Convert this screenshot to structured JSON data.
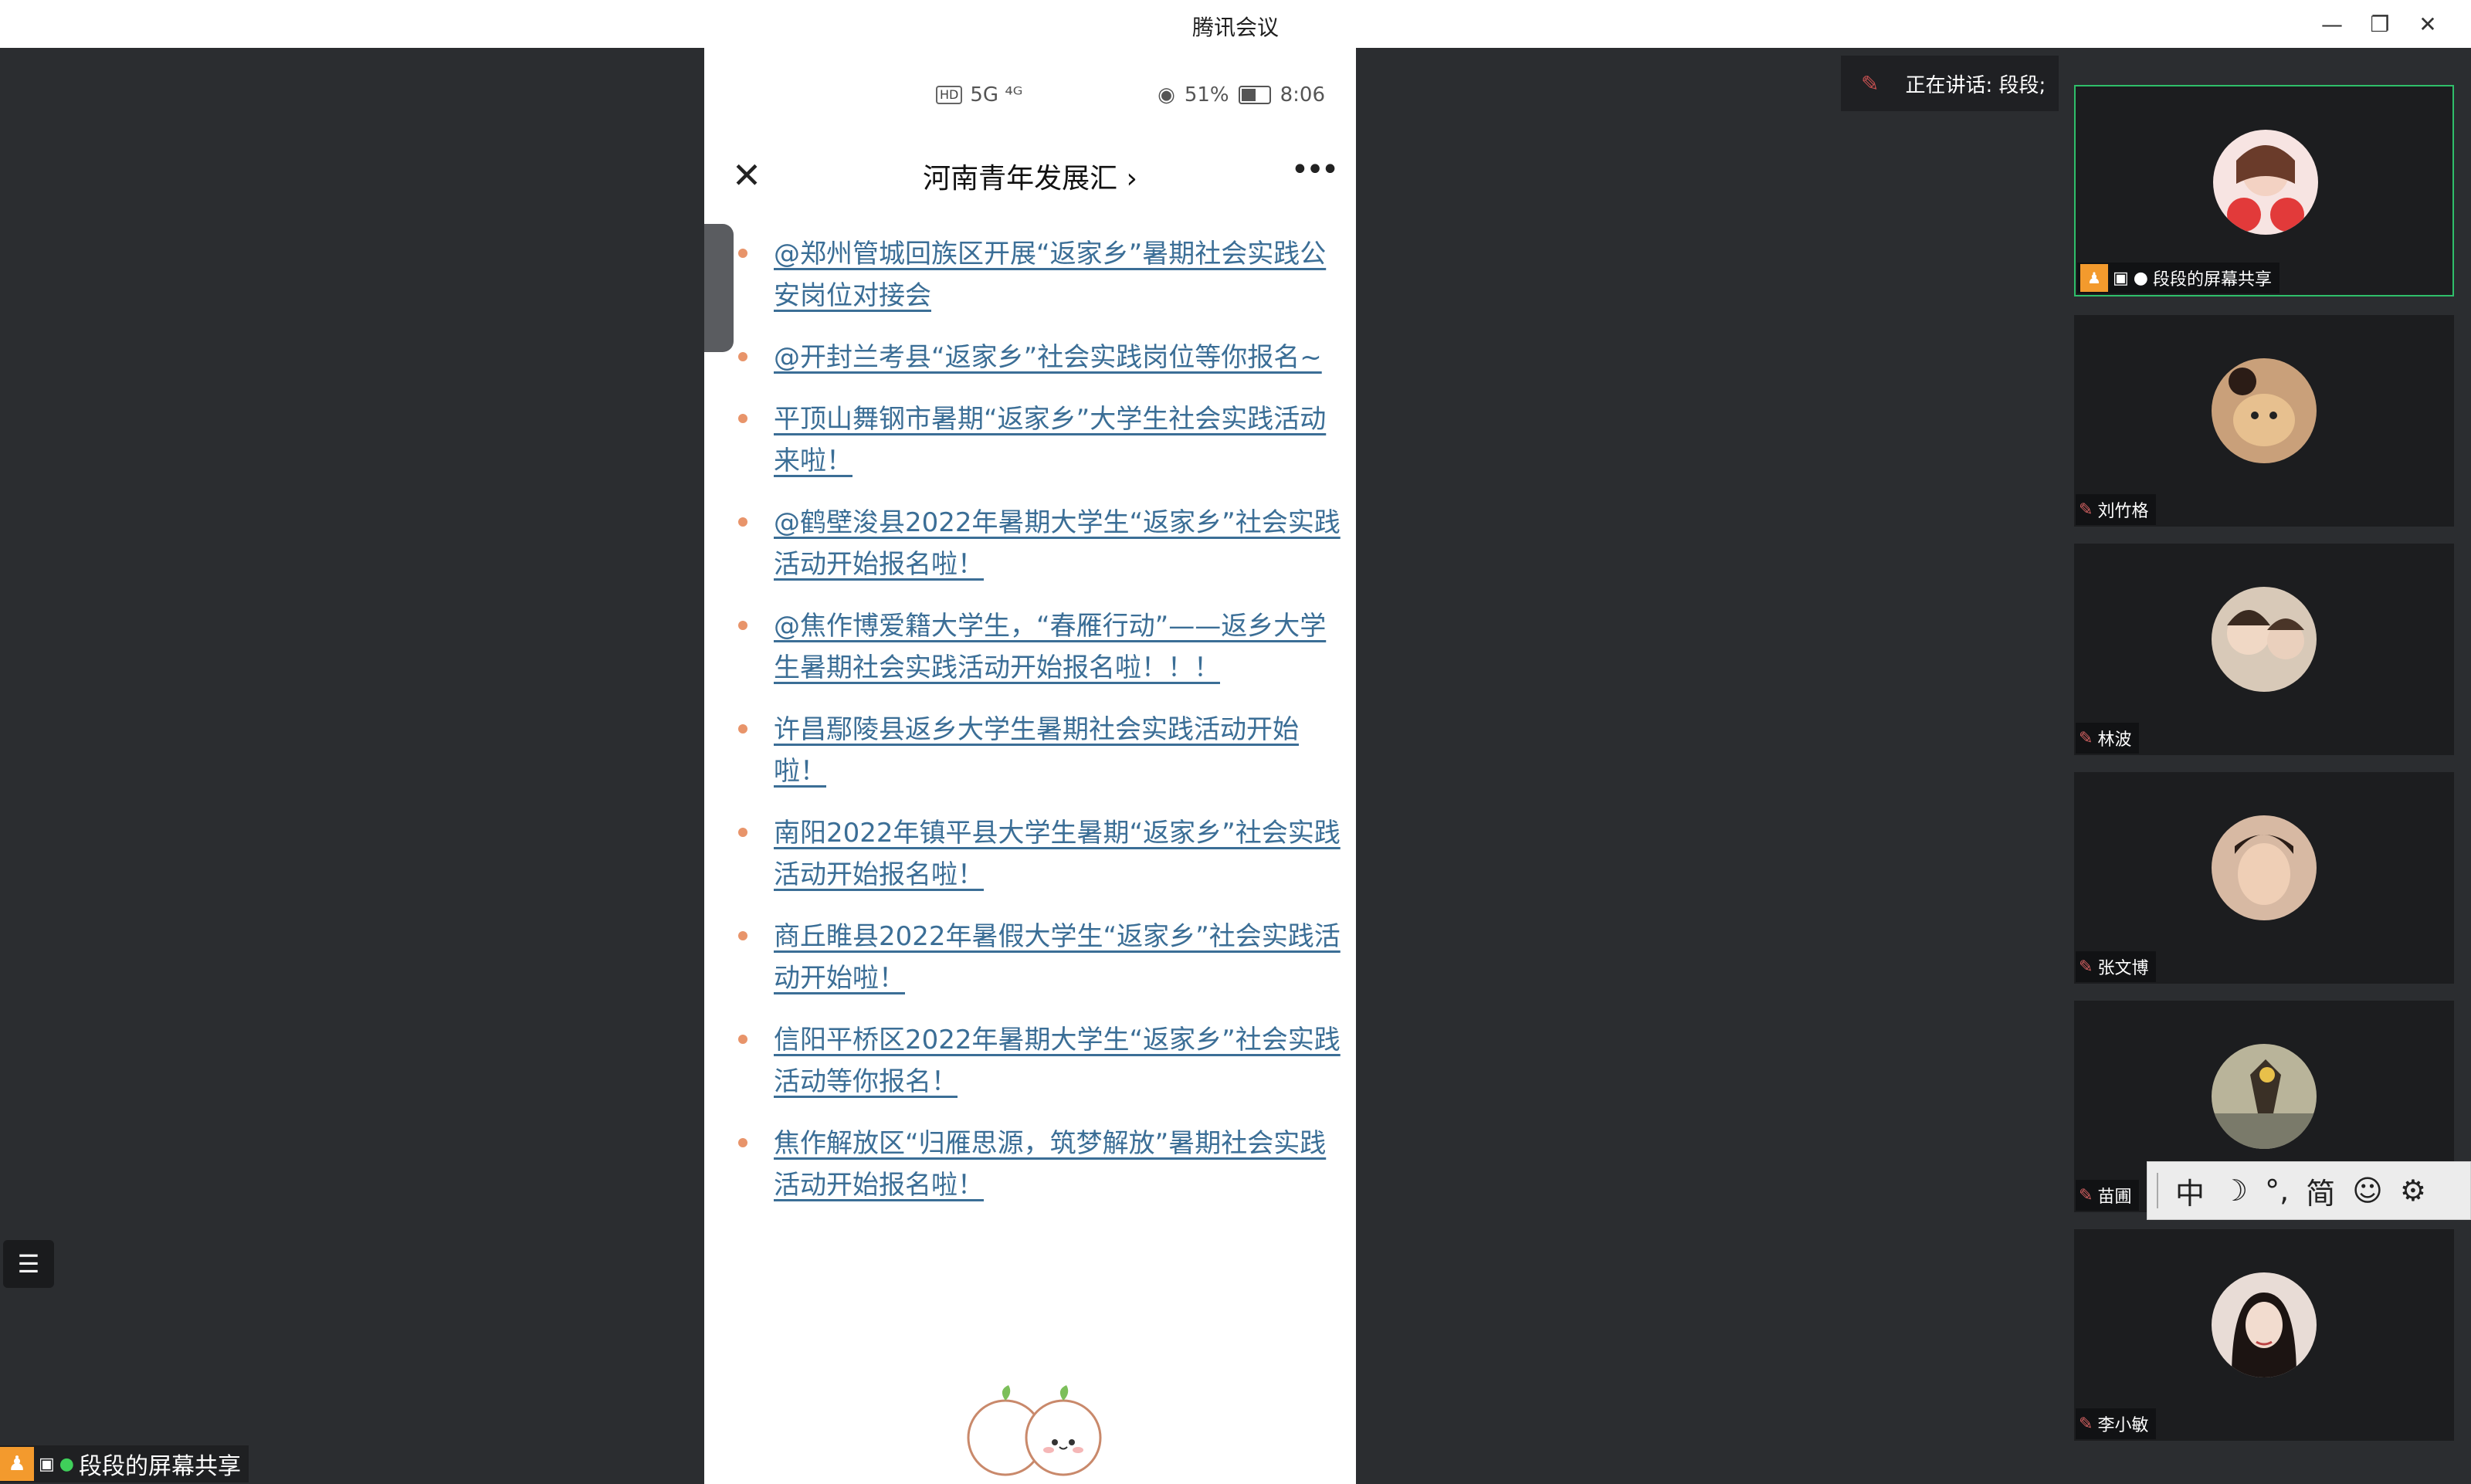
{
  "window": {
    "title": "腾讯会议",
    "controls": {
      "minimize": "—",
      "restore": "❐",
      "close": "✕"
    }
  },
  "phone": {
    "status_bar": {
      "badge": "HD",
      "signal": "5G ⁴ᴳ",
      "battery": "51%",
      "time": "8:06"
    },
    "header": {
      "close_glyph": "✕",
      "title": "河南青年发展汇",
      "title_chevron": "›",
      "more_glyph": "•••"
    },
    "articles": [
      "@郑州管城回族区开展“返家乡”暑期社会实践公安岗位对接会",
      "@开封兰考县“返家乡”社会实践岗位等你报名~",
      "平顶山舞钢市暑期“返家乡”大学生社会实践活动来啦！",
      "@鹤壁浚县2022年暑期大学生“返家乡”社会实践活动开始报名啦！",
      "@焦作博爱籍大学生，“春雁行动”——返乡大学生暑期社会实践活动开始报名啦！！！",
      "许昌鄢陵县返乡大学生暑期社会实践活动开始啦！",
      "南阳2022年镇平县大学生暑期“返家乡”社会实践活动开始报名啦！",
      "商丘睢县2022年暑假大学生“返家乡”社会实践活动开始啦！",
      "信阳平桥区2022年暑期大学生“返家乡”社会实践活动等你报名！",
      "焦作解放区“归雁思源，筑梦解放”暑期社会实践活动开始报名啦！"
    ]
  },
  "toolbar": {
    "list_icon": "☰"
  },
  "share_badge": {
    "text": "段段的屏幕共享"
  },
  "speaking": {
    "text": "正在讲话: 段段;"
  },
  "participants": [
    {
      "name": "段段的屏幕共享",
      "host": true,
      "color": "#f7e4e2"
    },
    {
      "name": "刘竹格",
      "host": false,
      "color": "#c9a07a"
    },
    {
      "name": "林波",
      "host": false,
      "color": "#d8c9b8"
    },
    {
      "name": "张文博",
      "host": false,
      "color": "#d7b9a3"
    },
    {
      "name": "苗圃",
      "host": false,
      "color": "#b9b49a"
    },
    {
      "name": "李小敏",
      "host": false,
      "color": "#e8dcd6"
    }
  ],
  "ime": {
    "items": [
      "中",
      "☽",
      "°,",
      "简",
      "☺",
      "⚙"
    ]
  },
  "colors": {
    "accent": "#2fbf6a",
    "link": "#3b6e96",
    "bullet": "#e8946a",
    "host": "#f39a2d"
  }
}
